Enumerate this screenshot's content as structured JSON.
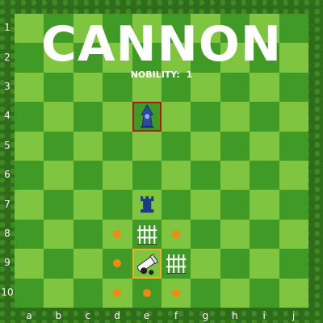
{
  "title": "CANNON",
  "nobility": {
    "label": "NOBILITY:",
    "value": "1"
  },
  "files": [
    "a",
    "b",
    "c",
    "d",
    "e",
    "f",
    "g",
    "h",
    "i",
    "j"
  ],
  "ranks": [
    "1",
    "2",
    "3",
    "4",
    "5",
    "6",
    "7",
    "8",
    "9",
    "10"
  ],
  "colors": {
    "light": "#7fc540",
    "dark": "#3f9a26",
    "highlight_red": "#b01717",
    "highlight_yellow": "#f0b020",
    "move_dot": "#f08a10",
    "enemy_piece": "#2b4aa8"
  },
  "pieces": [
    {
      "name": "wizard",
      "square": "e4",
      "side": "enemy",
      "icon": "wizard-icon"
    },
    {
      "name": "rook",
      "square": "e7",
      "side": "enemy",
      "icon": "rook-icon"
    },
    {
      "name": "fence",
      "square": "e8",
      "side": "player",
      "icon": "fence-icon"
    },
    {
      "name": "cannon",
      "square": "e9",
      "side": "player",
      "icon": "cannon-icon"
    },
    {
      "name": "fence",
      "square": "f9",
      "side": "player",
      "icon": "fence-icon"
    }
  ],
  "highlights": {
    "red": [
      "e4"
    ],
    "yellow": [
      "e9"
    ]
  },
  "move_dots": [
    "d8",
    "f8",
    "d9",
    "d10",
    "e10",
    "f10"
  ]
}
